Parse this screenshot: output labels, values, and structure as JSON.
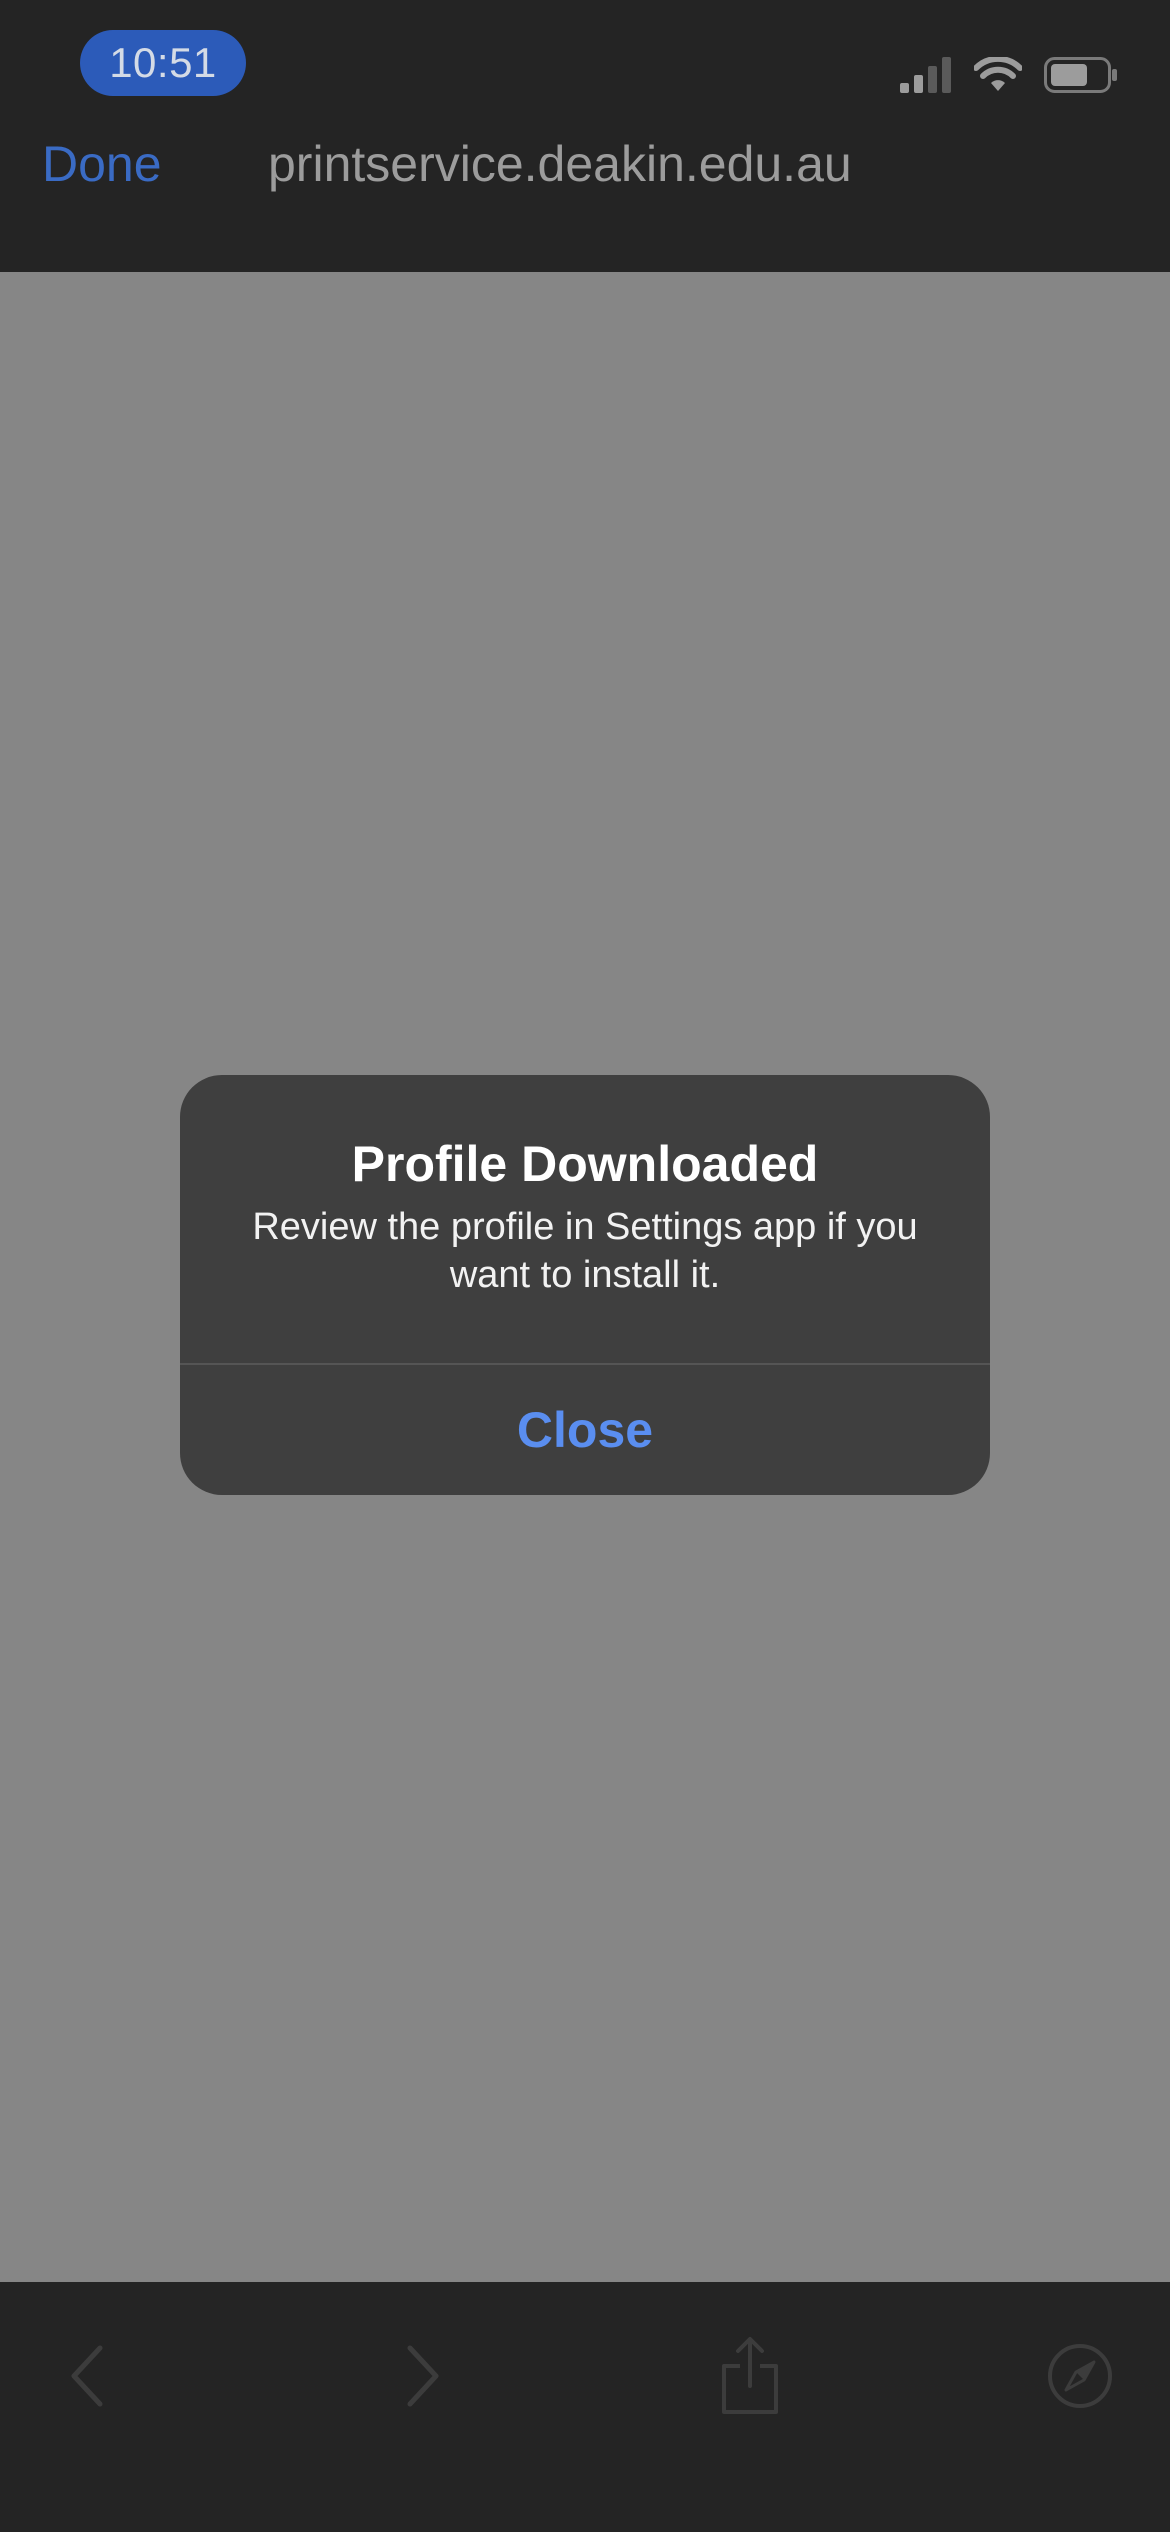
{
  "status_bar": {
    "time": "10:51",
    "signal_icon": "cellular-signal-icon",
    "wifi_icon": "wifi-icon",
    "battery_icon": "battery-icon"
  },
  "nav": {
    "done_label": "Done",
    "title": "printservice.deakin.edu.au"
  },
  "alert": {
    "title": "Profile Downloaded",
    "message": "Review the profile in Settings app if you want to install it.",
    "close_label": "Close"
  },
  "toolbar": {
    "items": [
      {
        "icon": "back-chevron-icon",
        "enabled": false
      },
      {
        "icon": "forward-chevron-icon",
        "enabled": false
      },
      {
        "icon": "share-icon",
        "enabled": false
      },
      {
        "icon": "compass-icon",
        "enabled": false
      }
    ]
  },
  "colors": {
    "accent": "#5a8ef0",
    "time_pill": "#2c5bb9",
    "overlay": "#868686",
    "bars": "#242424",
    "alert_bg": "#3f3f3f"
  }
}
